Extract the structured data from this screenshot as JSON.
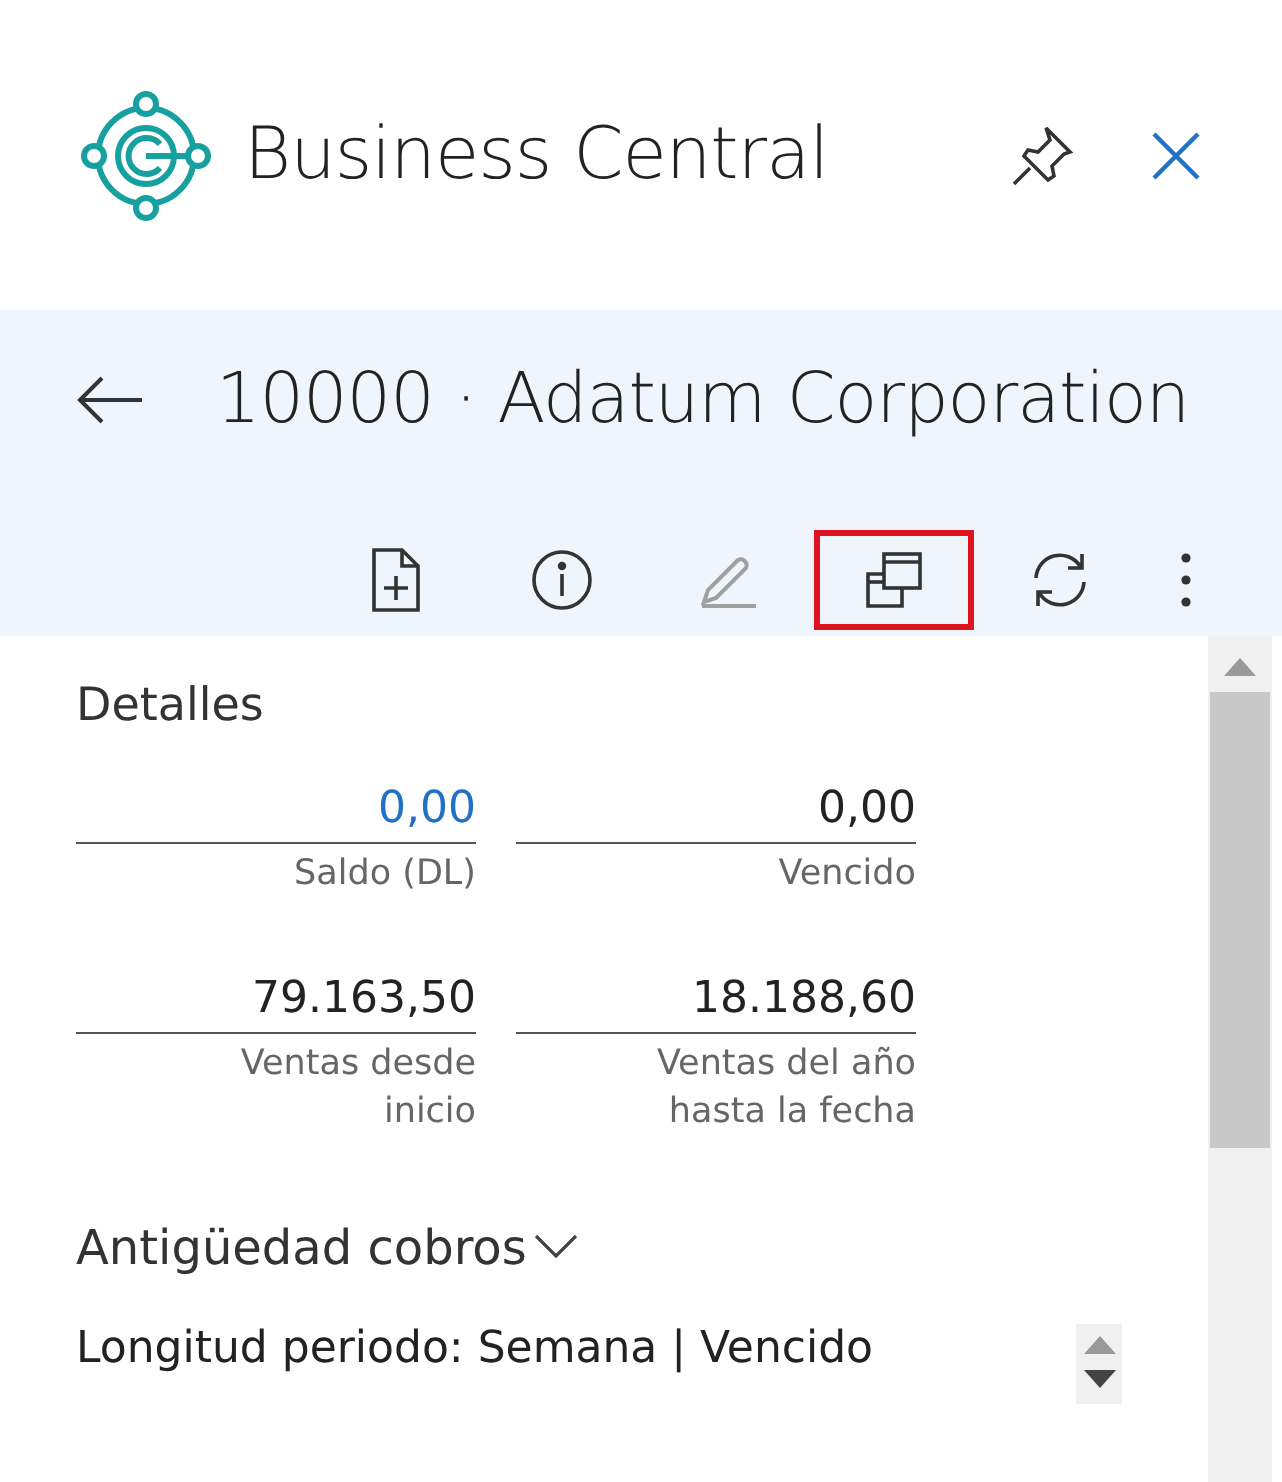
{
  "app": {
    "title": "Business Central"
  },
  "record": {
    "title": "10000 · Adatum Corporation"
  },
  "toolbar": [
    {
      "kind": "new-document",
      "disabled": false,
      "highlighted": false
    },
    {
      "kind": "info",
      "disabled": false,
      "highlighted": false
    },
    {
      "kind": "edit",
      "disabled": true,
      "highlighted": false
    },
    {
      "kind": "open-window",
      "disabled": false,
      "highlighted": true
    },
    {
      "kind": "refresh",
      "disabled": false,
      "highlighted": false
    },
    {
      "kind": "more",
      "disabled": false,
      "highlighted": false
    }
  ],
  "details": {
    "heading": "Detalles",
    "fields": [
      {
        "value": "0,00",
        "label": "Saldo (DL)",
        "link": true
      },
      {
        "value": "0,00",
        "label": "Vencido",
        "link": false
      },
      {
        "value": "79.163,50",
        "label": "Ventas desde inicio",
        "link": false
      },
      {
        "value": "18.188,60",
        "label": "Ventas del año hasta la fecha",
        "link": false
      }
    ]
  },
  "aging": {
    "heading": "Antigüedad cobros",
    "expanded": true,
    "filter": "Longitud periodo: Semana | Vencido"
  }
}
